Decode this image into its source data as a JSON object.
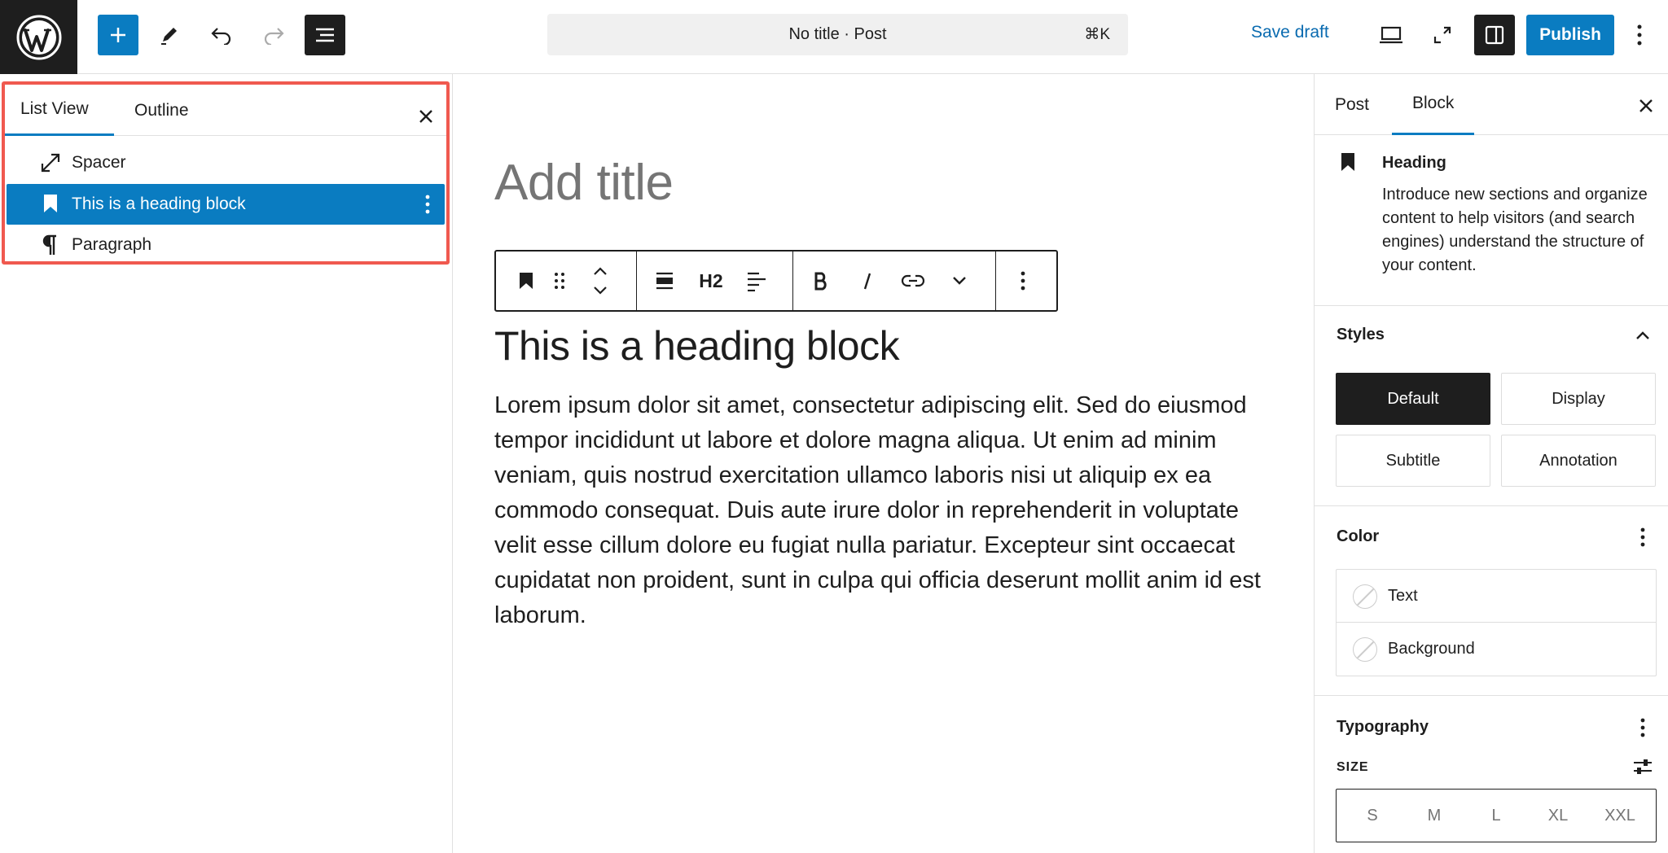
{
  "topbar": {
    "command_title": "No title · Post",
    "command_shortcut": "⌘K",
    "save_draft": "Save draft",
    "publish": "Publish"
  },
  "list_view": {
    "tabs": [
      {
        "label": "List View",
        "active": true
      },
      {
        "label": "Outline",
        "active": false
      }
    ],
    "items": [
      {
        "label": "Spacer",
        "icon": "resize-arrows-icon"
      },
      {
        "label": "This is a heading block",
        "icon": "bookmark-icon",
        "selected": true
      },
      {
        "label": "Paragraph",
        "icon": "pilcrow-icon"
      }
    ],
    "highlight_color": "#f0594f"
  },
  "editor": {
    "title_placeholder": "Add title",
    "toolbar": {
      "heading_level": "H2"
    },
    "heading": "This is a heading block",
    "paragraph": "Lorem ipsum dolor sit amet, consectetur adipiscing elit. Sed do eiusmod tempor incididunt ut labore et dolore magna aliqua. Ut enim ad minim veniam, quis nostrud exercitation ullamco laboris nisi ut aliquip ex ea commodo consequat. Duis aute irure dolor in reprehenderit in voluptate velit esse cillum dolore eu fugiat nulla pariatur. Excepteur sint occaecat cupidatat non proident, sunt in culpa qui officia deserunt mollit anim id est laborum."
  },
  "sidebar": {
    "tabs": [
      {
        "label": "Post",
        "active": false
      },
      {
        "label": "Block",
        "active": true
      }
    ],
    "block": {
      "name": "Heading",
      "description": "Introduce new sections and organize content to help visitors (and search engines) understand the structure of your content."
    },
    "styles": {
      "title": "Styles",
      "options": [
        {
          "label": "Default",
          "active": true
        },
        {
          "label": "Display",
          "active": false
        },
        {
          "label": "Subtitle",
          "active": false
        },
        {
          "label": "Annotation",
          "active": false
        }
      ]
    },
    "color": {
      "title": "Color",
      "items": [
        "Text",
        "Background"
      ]
    },
    "typography": {
      "title": "Typography",
      "size_label": "SIZE",
      "sizes": [
        "S",
        "M",
        "L",
        "XL",
        "XXL"
      ]
    }
  },
  "colors": {
    "accent": "#0a7cc1",
    "dark": "#1e1e1e"
  }
}
